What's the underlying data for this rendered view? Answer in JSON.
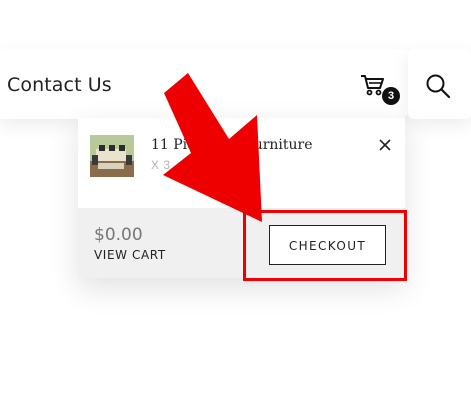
{
  "nav": {
    "contact_label": "Contact Us",
    "cart_count": "3",
    "cart_icon": "cart-icon",
    "search_icon": "search-icon"
  },
  "mini_cart": {
    "item": {
      "title": "11 Piece Set Furniture",
      "qty": "X 3",
      "remove_icon": "close-icon"
    },
    "subtotal": "$0.00",
    "view_cart_label": "VIEW CART",
    "checkout_label": "CHECKOUT"
  },
  "annotation": {
    "arrow_color": "#ee0000",
    "highlight_color": "#ee0000"
  }
}
